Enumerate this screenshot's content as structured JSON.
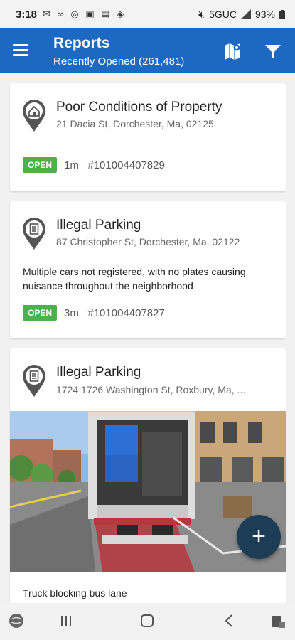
{
  "status_bar": {
    "time": "3:18",
    "network": "5GUC",
    "battery": "93%"
  },
  "app_bar": {
    "title": "Reports",
    "subtitle": "Recently Opened (261,481)"
  },
  "reports": [
    {
      "title": "Poor Conditions of Property",
      "address": "21 Dacia St, Dorchester, Ma, 02125",
      "description": "",
      "status": "OPEN",
      "age": "1m",
      "id": "#101004407829",
      "icon": "house-pin-icon"
    },
    {
      "title": "Illegal Parking",
      "address": "87 Christopher St, Dorchester, Ma, 02122",
      "description": "Multiple cars not registered, with no plates causing nuisance throughout the neighborhood",
      "status": "OPEN",
      "age": "3m",
      "id": "#101004407827",
      "icon": "document-pin-icon"
    },
    {
      "title": "Illegal Parking",
      "address": "1724 1726 Washington St, Roxbury, Ma, ...",
      "description": "Truck blocking bus lane",
      "icon": "document-pin-icon"
    }
  ],
  "fab": {
    "label": "+"
  },
  "colors": {
    "app_bar": "#1d68c0",
    "open_badge": "#4caf50",
    "fab": "#1c3d55"
  }
}
